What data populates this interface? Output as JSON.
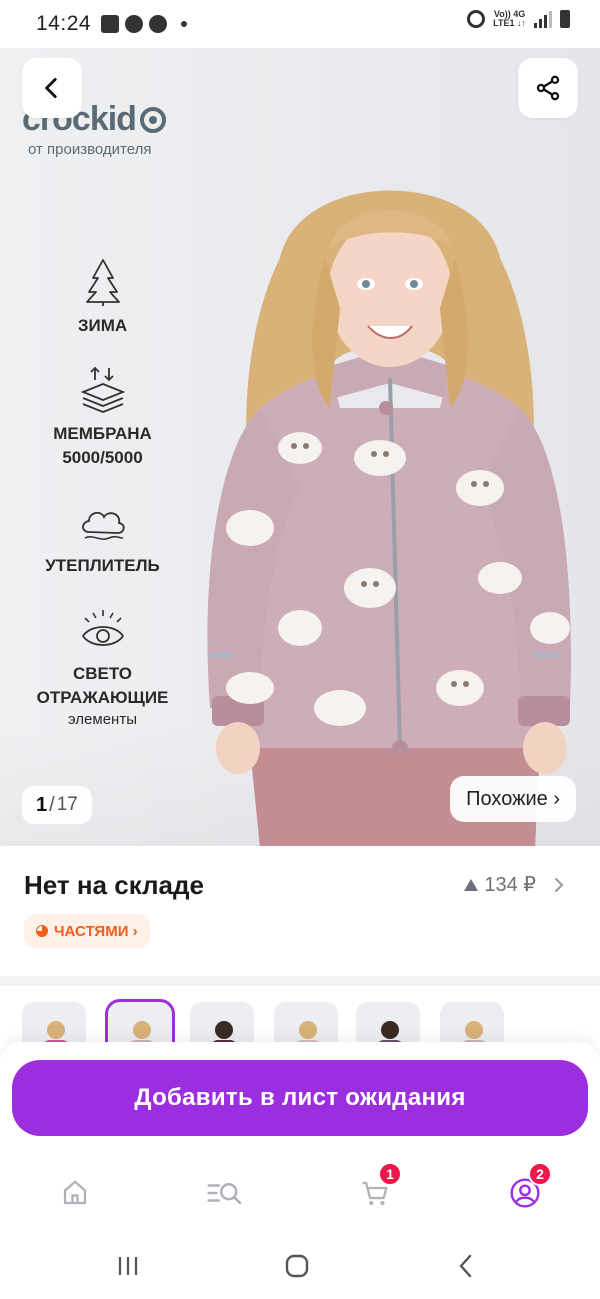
{
  "status_bar": {
    "time": "14:24",
    "network_label_top": "Vo)) 4G",
    "network_label_bottom": "LTE1 ↓↑"
  },
  "hero": {
    "brand_name": "crockid",
    "brand_subtitle": "от производителя",
    "features": [
      {
        "icon": "tree-icon",
        "title": "ЗИМА",
        "subtitle": ""
      },
      {
        "icon": "membrane-icon",
        "title": "МЕМБРАНА",
        "subtitle_bold": "5000/5000"
      },
      {
        "icon": "cloud-insulation-icon",
        "title": "УТЕПЛИТЕЛЬ",
        "subtitle": ""
      },
      {
        "icon": "eye-icon",
        "title": "СВЕТО",
        "title_line2": "ОТРАЖАЮЩИЕ",
        "subtitle": "элементы"
      }
    ],
    "counter_current": "1",
    "counter_sep": "/",
    "counter_total": "17",
    "similar_label": "Похожие ›"
  },
  "product": {
    "stock_status": "Нет на складе",
    "price_history": "134 ₽",
    "installments_label": "ЧАСТЯМИ ›"
  },
  "thumbnails": {
    "count": 6,
    "active_index": 1,
    "jacket_colors": [
      "#c05aa0",
      "#cbb1c2",
      "#5a2a45",
      "#d7b9c6",
      "#6b5070",
      "#c9b0bf"
    ]
  },
  "cta": {
    "label": "Добавить в лист ожидания",
    "color": "#9b2fe0"
  },
  "bottom_nav": {
    "items": [
      {
        "name": "home",
        "icon": "home-icon",
        "badge": ""
      },
      {
        "name": "catalog",
        "icon": "catalog-search-icon",
        "badge": ""
      },
      {
        "name": "cart",
        "icon": "cart-icon",
        "badge": "1"
      },
      {
        "name": "profile",
        "icon": "profile-icon",
        "badge": "2"
      }
    ],
    "accent_color": "#9b2fe0",
    "badge_color": "#f0164a"
  }
}
